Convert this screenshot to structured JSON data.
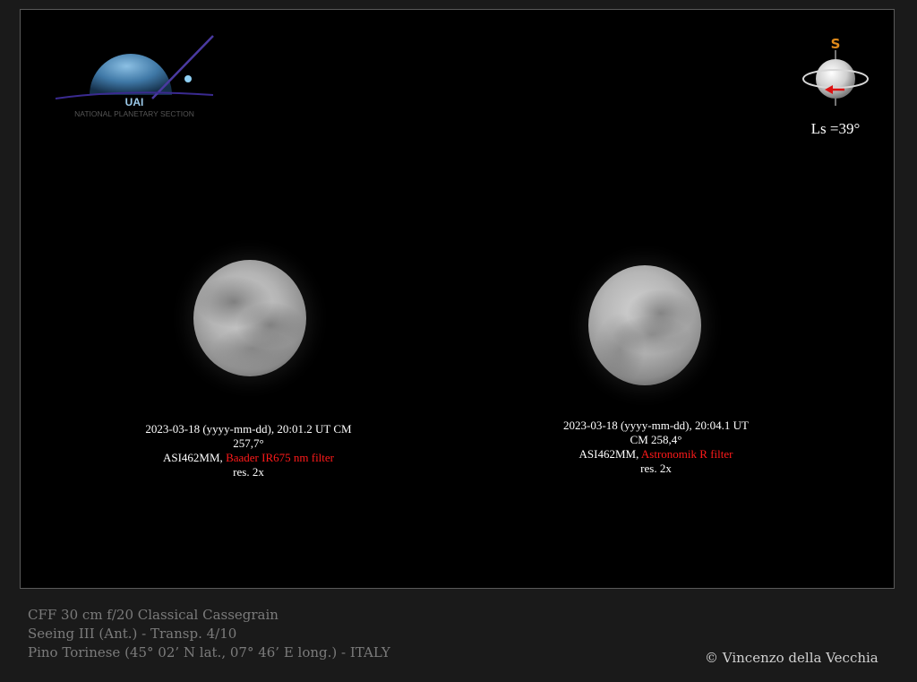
{
  "logo": {
    "acronym": "UAI",
    "section": "NATIONAL PLANETARY SECTION"
  },
  "orientation": {
    "pole": "S",
    "ls_label": "Ls =39°"
  },
  "images": [
    {
      "line1": "2023-03-18 (yyyy-mm-dd), 20:01.2 UT  CM",
      "line2": "257,7°",
      "camera": "ASI462MM, ",
      "filter": "Baader IR675 nm filter",
      "res": "res. 2x"
    },
    {
      "line1": "2023-03-18  (yyyy-mm-dd), 20:04.1  UT",
      "line2": "CM 258,4°",
      "camera": "ASI462MM, ",
      "filter": "Astronomik R filter",
      "res": "res. 2x"
    }
  ],
  "footer": {
    "telescope": "CFF 30 cm f/20 Classical Cassegrain",
    "seeing": "Seeing  III (Ant.) - Transp. 4/10",
    "location": "Pino Torinese (45° 02’ N lat., 07° 46’ E long.) - ITALY"
  },
  "copyright": "© Vincenzo della Vecchia",
  "colors": {
    "filter_text": "#ff1a1a",
    "pole_label": "#e08a1a",
    "rotation_arrow": "#dd1111",
    "footer_text": "#7b7b7b"
  }
}
